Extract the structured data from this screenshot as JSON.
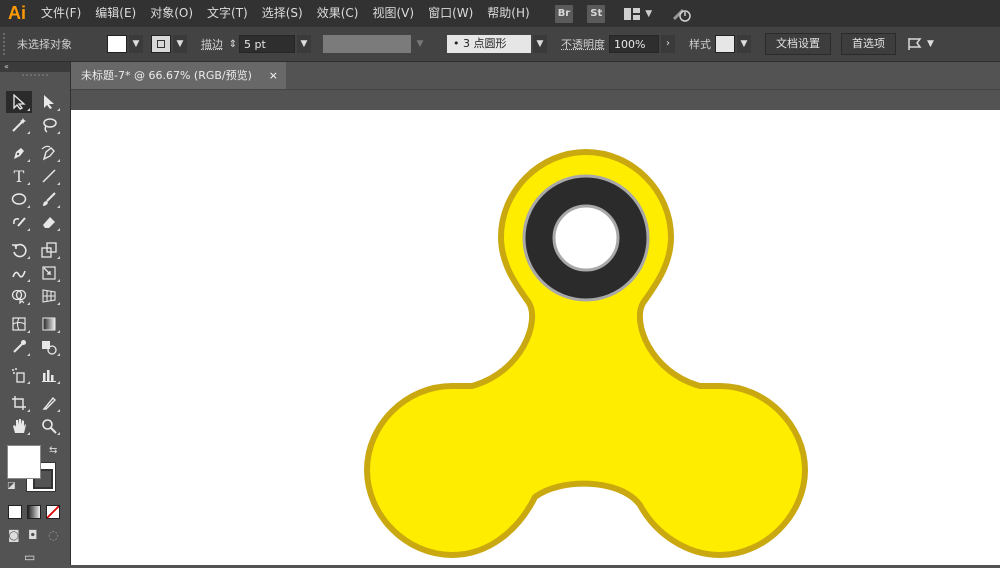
{
  "app": {
    "logo": "Ai"
  },
  "menu": [
    "文件(F)",
    "编辑(E)",
    "对象(O)",
    "文字(T)",
    "选择(S)",
    "效果(C)",
    "视图(V)",
    "窗口(W)",
    "帮助(H)"
  ],
  "menu_icons": {
    "bridge": "Br",
    "stock": "St"
  },
  "control": {
    "selection_status": "未选择对象",
    "stroke_label": "描边",
    "stroke_weight": "5 pt",
    "brush": "•  3 点圆形",
    "opacity_label": "不透明度",
    "opacity_value": "100%",
    "style_label": "样式",
    "doc_setup": "文档设置",
    "preferences": "首选项"
  },
  "document": {
    "tab_title": "未标题-7* @ 66.67% (RGB/预览)",
    "close": "×"
  },
  "colors": {
    "spinner_fill": "#ffed00",
    "spinner_stroke": "#c9a810",
    "bearing_ring": "#2b2b2b",
    "bearing_edge": "#a8a8a8",
    "bearing_hole": "#ffffff",
    "accent_logo": "#ff9a00"
  },
  "tools": [
    [
      "selection-icon",
      "direct-selection-icon"
    ],
    [
      "magic-wand-icon",
      "lasso-icon"
    ],
    [
      "pen-icon",
      "curvature-icon"
    ],
    [
      "type-icon",
      "line-segment-icon"
    ],
    [
      "ellipse-icon",
      "paintbrush-icon"
    ],
    [
      "shaper-icon",
      "eraser-icon"
    ],
    [
      "rotate-icon",
      "scale-icon"
    ],
    [
      "warp-icon",
      "free-transform-icon"
    ],
    [
      "shape-builder-icon",
      "perspective-grid-icon"
    ],
    [
      "mesh-icon",
      "gradient-icon"
    ],
    [
      "eyedropper-icon",
      "blend-icon"
    ],
    [
      "symbol-sprayer-icon",
      "column-graph-icon"
    ],
    [
      "artboard-icon",
      "slice-icon"
    ],
    [
      "hand-icon",
      "zoom-icon"
    ]
  ]
}
